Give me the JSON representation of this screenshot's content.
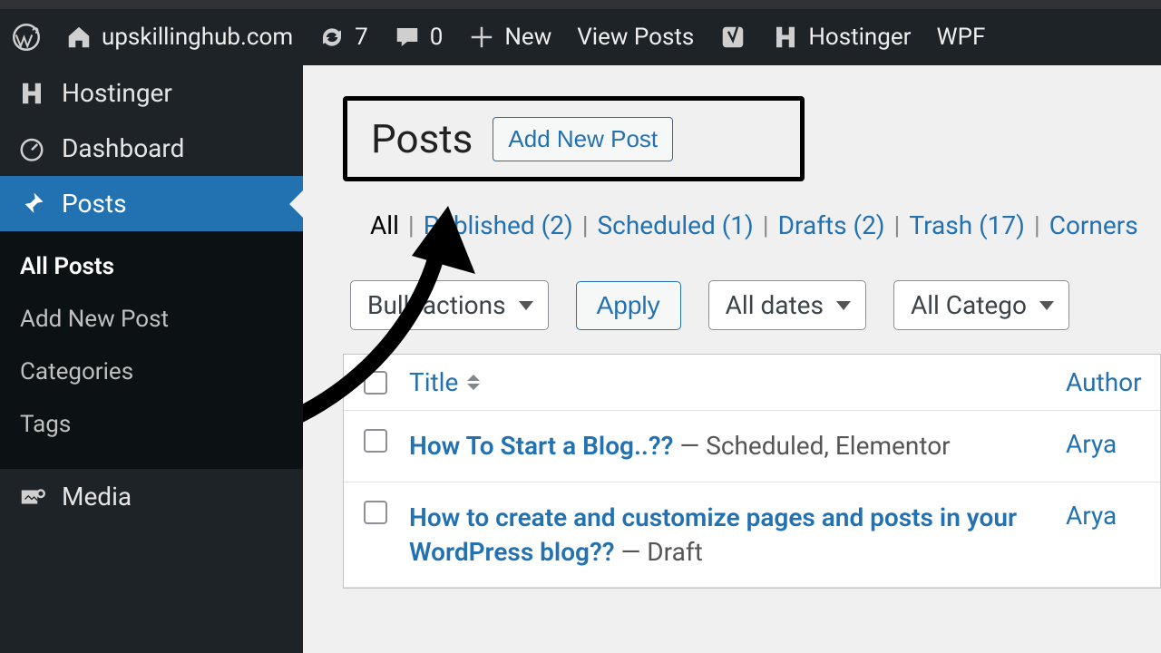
{
  "adminbar": {
    "site": "upskillinghub.com",
    "updates": "7",
    "comments": "0",
    "new": "New",
    "viewposts": "View Posts",
    "hostinger": "Hostinger",
    "extra": "WPF"
  },
  "sidebar": {
    "hostinger": "Hostinger",
    "dashboard": "Dashboard",
    "posts": "Posts",
    "media": "Media",
    "sub": {
      "all": "All Posts",
      "add": "Add New Post",
      "cat": "Categories",
      "tags": "Tags"
    }
  },
  "page": {
    "title": "Posts",
    "addnew": "Add New Post"
  },
  "statuses": {
    "all_label": "All",
    "published": "Published (2)",
    "scheduled": "Scheduled (1)",
    "drafts": "Drafts (2)",
    "trash": "Trash (17)",
    "corner": "Corners"
  },
  "filters": {
    "bulk": "Bulk actions",
    "apply": "Apply",
    "dates": "All dates",
    "cats": "All Catego"
  },
  "table": {
    "title": "Title",
    "author": "Author",
    "rows": [
      {
        "title": "How To Start a Blog..??",
        "meta": " — Scheduled, Elementor",
        "author": "Arya"
      },
      {
        "title": "How to create and customize pages and posts in your WordPress blog??",
        "meta": " — Draft",
        "author": "Arya"
      }
    ]
  }
}
